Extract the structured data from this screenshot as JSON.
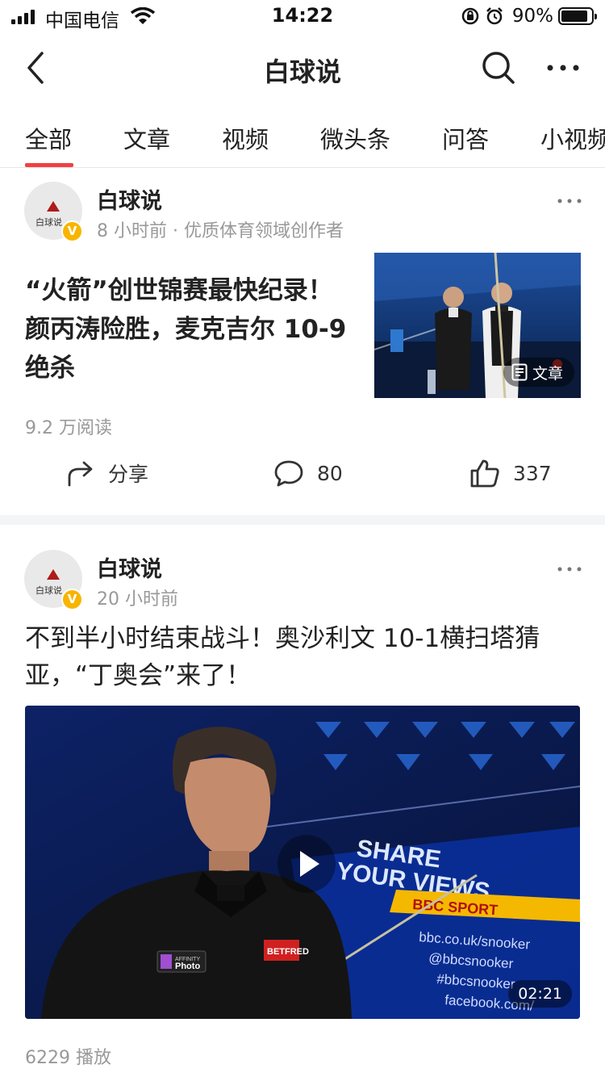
{
  "status_bar": {
    "carrier": "中国电信",
    "time": "14:22",
    "battery": "90%",
    "battery_level": 0.9
  },
  "nav": {
    "title": "白球说",
    "back_icon": "chevron-left-icon",
    "search_icon": "search-icon",
    "more_icon": "more-horizontal-icon"
  },
  "tabs": {
    "items": [
      "全部",
      "文章",
      "视频",
      "微头条",
      "问答",
      "小视频"
    ],
    "active": "全部",
    "accent": "#f04142"
  },
  "posts": [
    {
      "author": "白球说",
      "meta": "8 小时前 · 优质体育领域创作者",
      "title": "“火箭”创世锦赛最快纪录！颜丙涛险胜，麦克吉尔 10-9绝杀",
      "thumb_badge": "文章",
      "reads": "9.2 万阅读",
      "actions": {
        "share": "分享",
        "comments": "80",
        "likes": "337"
      }
    },
    {
      "author": "白球说",
      "meta": "20 小时前",
      "title": "不到半小时结束战斗！奥沙利文 10-1横扫塔猜亚，“丁奥会”来了！",
      "video_duration": "02:21",
      "video_overlay": {
        "line1": "SHARE",
        "line2": "YOUR VIEWS",
        "brand": "BBC SPORT",
        "web": "bbc.co.uk/snooker",
        "handle1": "@bbcsnooker",
        "handle2": "#bbcsnooker",
        "handle3": "facebook.com/",
        "patch1": "Photo",
        "patch1_small": "AFFINITY",
        "patch2": "BETFRED"
      },
      "plays": "6229 播放"
    }
  ],
  "avatar_logo_text": "白球说"
}
